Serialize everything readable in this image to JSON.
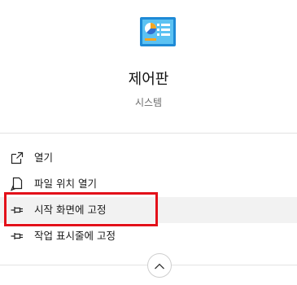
{
  "app": {
    "name": "제어판",
    "category": "시스템",
    "icon": "control-panel-icon"
  },
  "menu": {
    "items": [
      {
        "label": "열기",
        "icon": "open-icon"
      },
      {
        "label": "파일 위치 열기",
        "icon": "file-location-icon"
      },
      {
        "label": "시작 화면에 고정",
        "icon": "pin-icon",
        "highlighted": true
      },
      {
        "label": "작업 표시줄에 고정",
        "icon": "pin-icon"
      }
    ]
  },
  "controls": {
    "collapse_icon": "chevron-up-icon"
  },
  "colors": {
    "highlight_border": "#e3111a",
    "highlight_background": "#f2f2f2",
    "icon_blue": "#1e8ad6"
  }
}
